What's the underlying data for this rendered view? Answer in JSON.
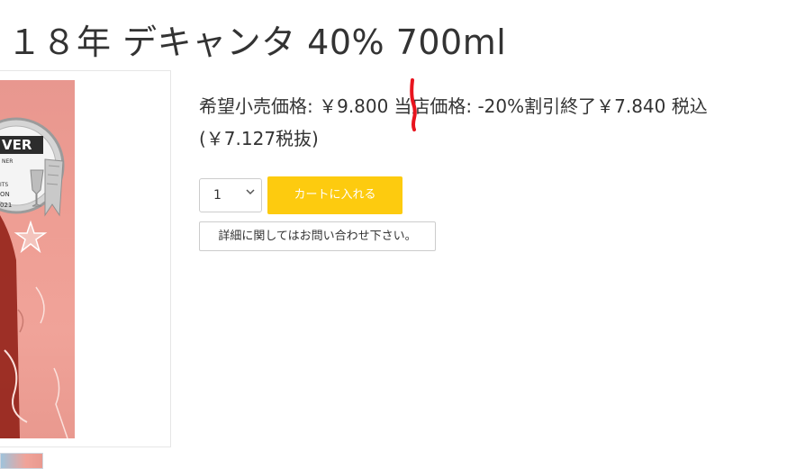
{
  "product": {
    "title": "１８年 デキャンタ 40% 700ml"
  },
  "pricing": {
    "msrp_text": "希望小売価格: ￥9.800",
    "store_price_text": "当店価格: -20%割引終了￥7.840 税込",
    "tax_excluded_text": "(￥7.127税抜)"
  },
  "cart": {
    "quantity_value": "1",
    "add_to_cart_label": "カートに入れる",
    "add_to_cart_color": "#fdcb0f"
  },
  "inquiry": {
    "label": "詳細に関してはお問い合わせ下さい。"
  },
  "image": {
    "label_fragments": [
      "VER",
      "NER",
      "ITS",
      "ON",
      "021"
    ]
  },
  "colors": {
    "annotation_mark": "#e8141e",
    "image_background": "#ee9d93"
  }
}
